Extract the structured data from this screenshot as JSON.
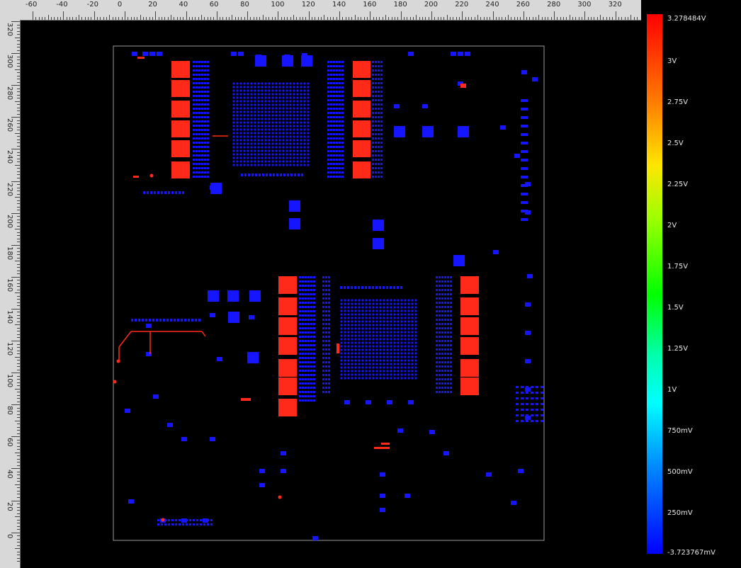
{
  "ruler_top": {
    "labels": [
      "-60",
      "-40",
      "-20",
      "0",
      "20",
      "40",
      "60",
      "80",
      "100",
      "120",
      "140",
      "160",
      "180",
      "200",
      "220",
      "240",
      "260",
      "280",
      "300",
      "320"
    ]
  },
  "ruler_left": {
    "labels": [
      "320",
      "300",
      "280",
      "260",
      "240",
      "220",
      "200",
      "180",
      "160",
      "140",
      "120",
      "100",
      "80",
      "60",
      "40",
      "20",
      "0"
    ]
  },
  "legend": {
    "title": "",
    "max_label": "3.278484V",
    "min_label": "-3.723767mV",
    "labels": [
      "3V",
      "2.75V",
      "2.5V",
      "2.25V",
      "2V",
      "1.75V",
      "1.5V",
      "1.25V",
      "1V",
      "750mV",
      "500mV",
      "250mV"
    ],
    "colors": {
      "high": "#ff0000",
      "mid": "#00ff00",
      "low": "#0000ff"
    }
  },
  "colors": {
    "pad_low": "#1515ff",
    "pad_high": "#ff2a1a",
    "board_outline": "#9a9a9a",
    "ruler_bg": "#d8d8d8"
  }
}
